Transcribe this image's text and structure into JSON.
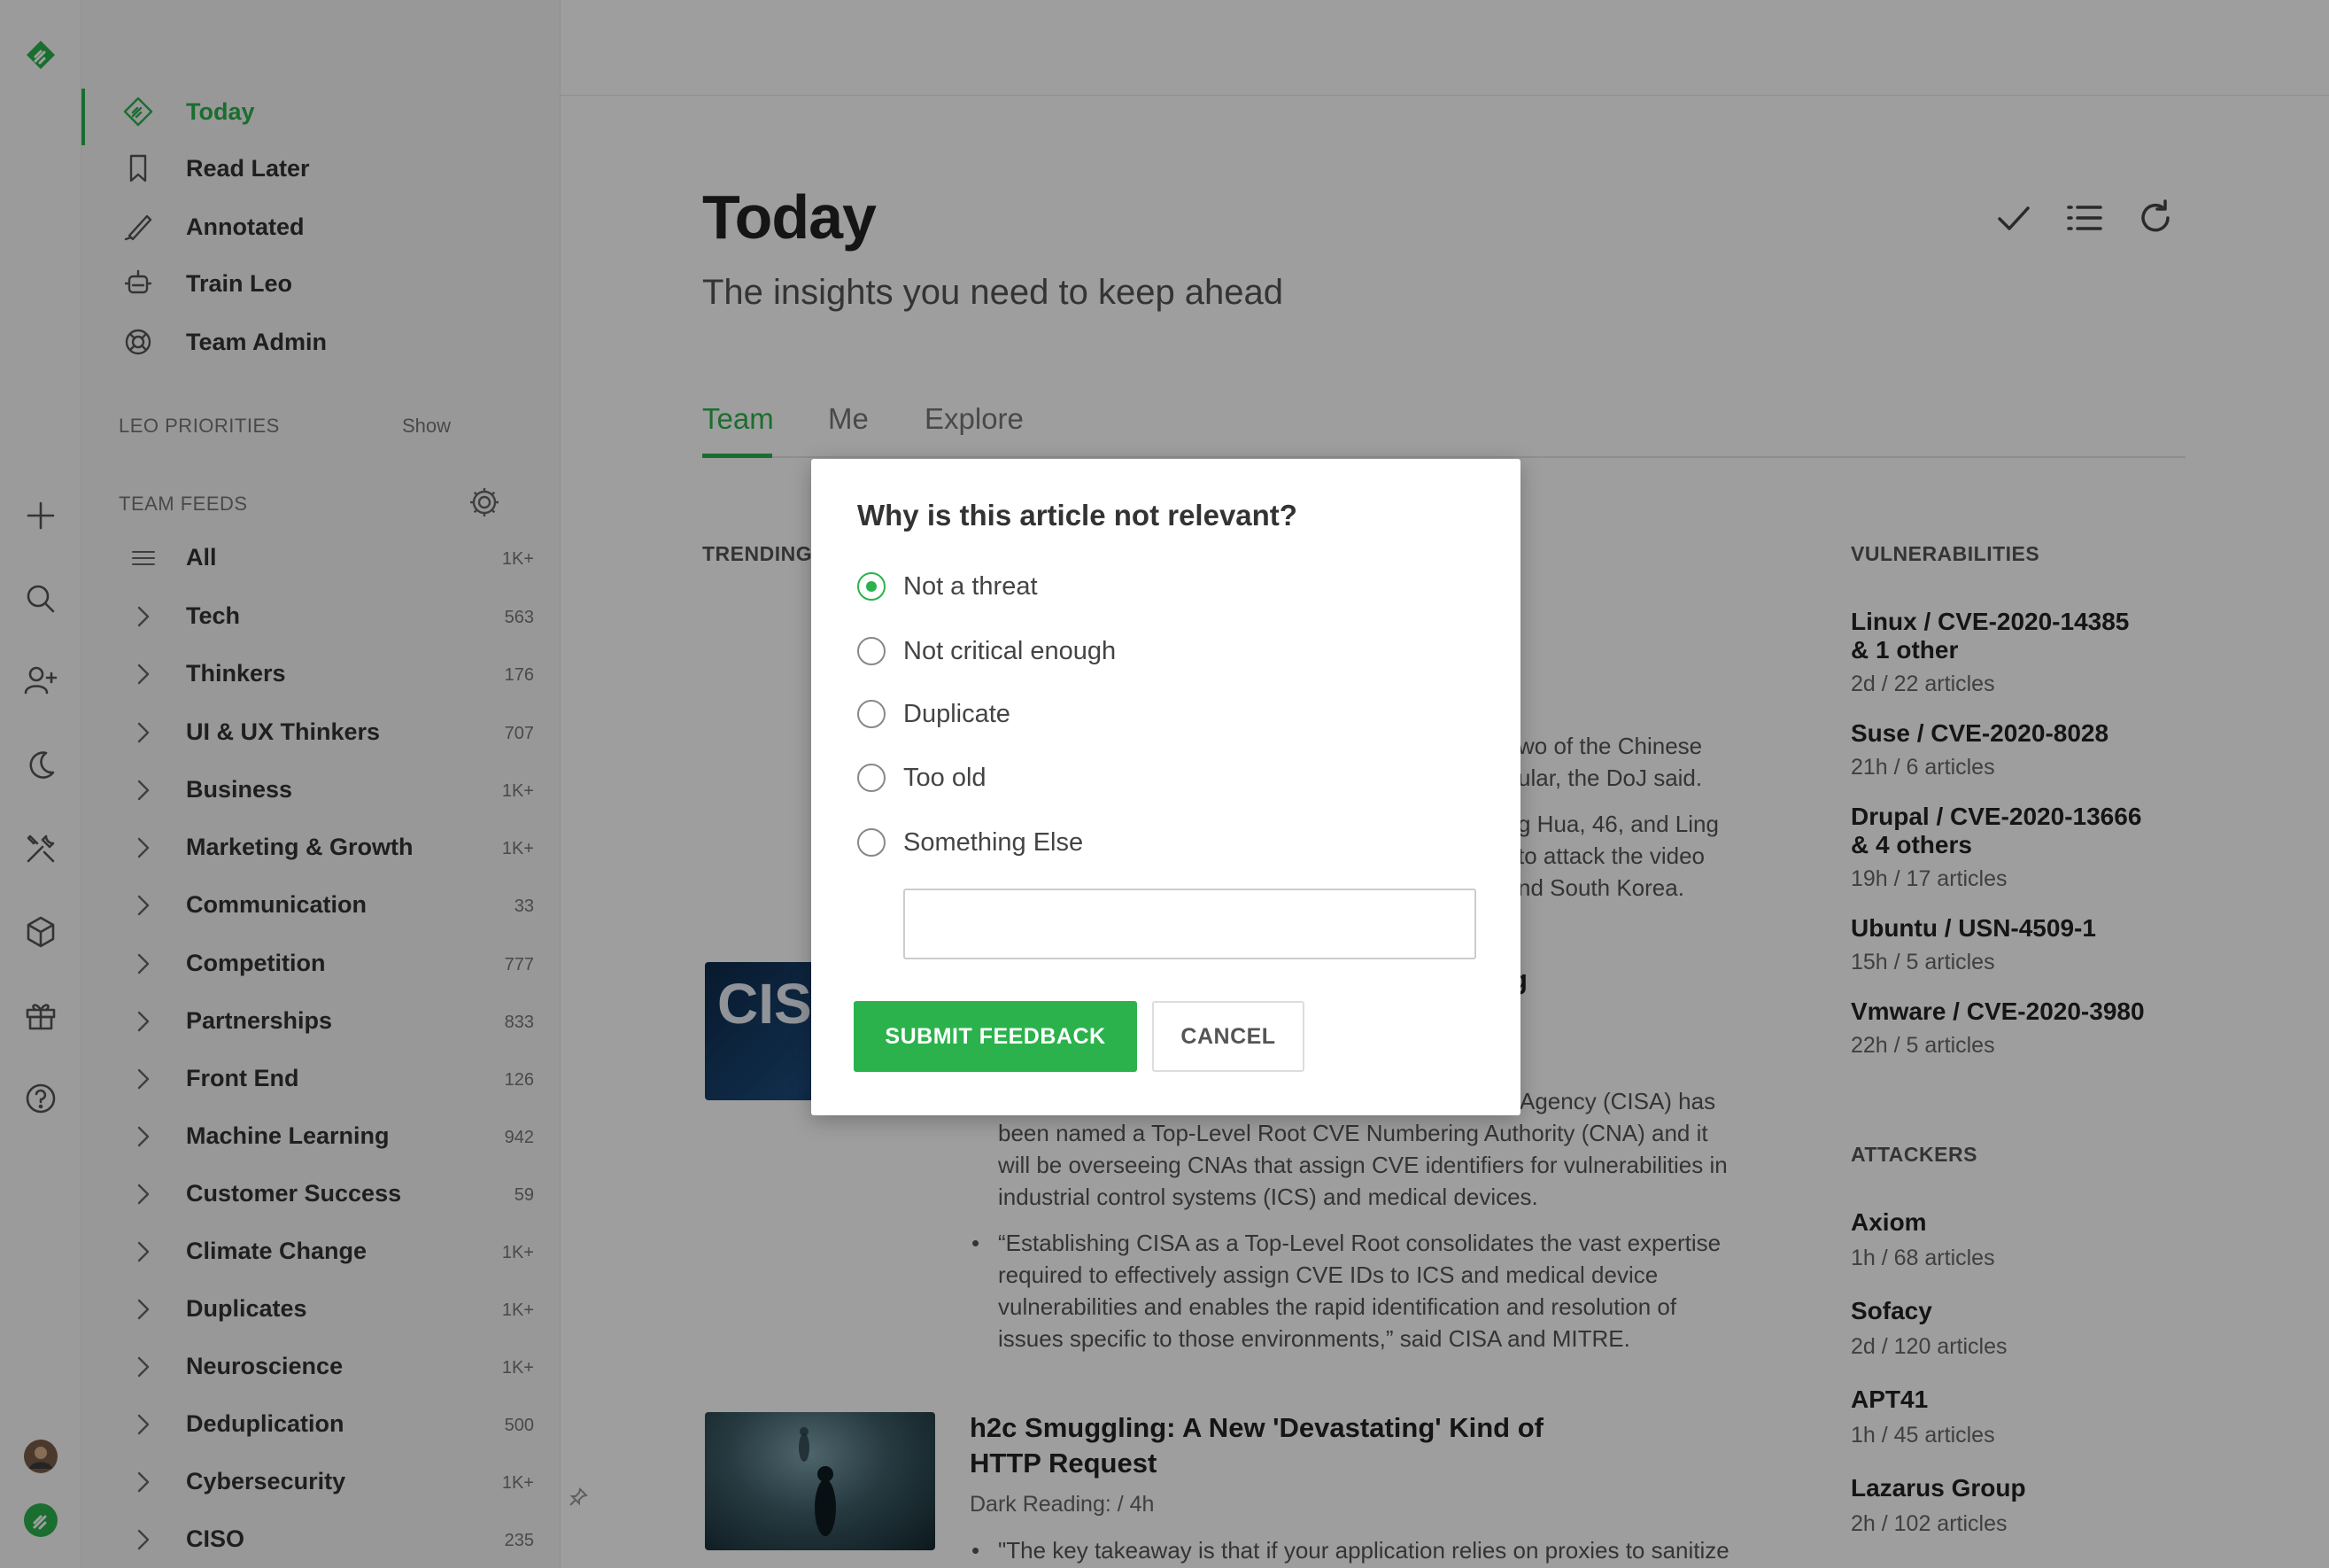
{
  "sidebar": {
    "nav": [
      {
        "label": "Today",
        "icon": "today-icon",
        "active": true
      },
      {
        "label": "Read Later",
        "icon": "bookmark-icon"
      },
      {
        "label": "Annotated",
        "icon": "highlighter-icon"
      },
      {
        "label": "Train Leo",
        "icon": "robot-icon"
      },
      {
        "label": "Team Admin",
        "icon": "lifebuoy-icon"
      }
    ],
    "leo_priorities": {
      "header": "LEO PRIORITIES",
      "action": "Show"
    },
    "team_feeds": {
      "header": "TEAM FEEDS",
      "items": [
        {
          "name": "All",
          "count": "1K+"
        },
        {
          "name": "Tech",
          "count": "563"
        },
        {
          "name": "Thinkers",
          "count": "176"
        },
        {
          "name": "UI & UX Thinkers",
          "count": "707"
        },
        {
          "name": "Business",
          "count": "1K+"
        },
        {
          "name": "Marketing & Growth",
          "count": "1K+"
        },
        {
          "name": "Communication",
          "count": "33"
        },
        {
          "name": "Competition",
          "count": "777"
        },
        {
          "name": "Partnerships",
          "count": "833"
        },
        {
          "name": "Front End",
          "count": "126"
        },
        {
          "name": "Machine Learning",
          "count": "942"
        },
        {
          "name": "Customer Success",
          "count": "59"
        },
        {
          "name": "Climate Change",
          "count": "1K+"
        },
        {
          "name": "Duplicates",
          "count": "1K+"
        },
        {
          "name": "Neuroscience",
          "count": "1K+"
        },
        {
          "name": "Deduplication",
          "count": "500"
        },
        {
          "name": "Cybersecurity",
          "count": "1K+"
        },
        {
          "name": "CISO",
          "count": "235"
        }
      ]
    }
  },
  "main": {
    "title": "Today",
    "subtitle": "The insights you need to keep ahead",
    "tabs": [
      {
        "label": "Team",
        "active": true
      },
      {
        "label": "Me"
      },
      {
        "label": "Explore"
      }
    ],
    "trending_header": "TRENDING",
    "article1": {
      "text_lines": [
        "wo of the Chinese",
        "ular, the DoJ said.",
        "g Hua, 46, and Ling",
        "to attack the video",
        "nd South Korea."
      ]
    },
    "article2": {
      "title_fragment": "g",
      "thumb_text": "CISO",
      "body_lines": [
        "Agency (CISA) has",
        "been named a Top-Level Root CVE Numbering Authority (CNA) and it",
        "will be overseeing CNAs that assign CVE identifiers for vulnerabilities in",
        "industrial control systems (ICS) and medical devices."
      ],
      "bullet_lines": [
        "“Establishing CISA as a Top-Level Root consolidates the vast expertise",
        "required to effectively assign CVE IDs to ICS and medical device",
        "vulnerabilities and enables the rapid identification and resolution of",
        "issues specific to those environments,” said CISA and MITRE."
      ]
    },
    "article3": {
      "title_line1": "h2c Smuggling: A New 'Devastating' Kind of",
      "title_line2": "HTTP Request",
      "source": "Dark Reading: / 4h",
      "bullet": "\"The key takeaway is that if your application relies on proxies to sanitize"
    },
    "vulnerabilities": {
      "header": "VULNERABILITIES",
      "items": [
        {
          "line1": "Linux / CVE-2020-14385",
          "line2": "& 1 other",
          "meta": "2d  /  22 articles"
        },
        {
          "line1": "Suse / CVE-2020-8028",
          "line2": "",
          "meta": "21h  /  6 articles"
        },
        {
          "line1": "Drupal / CVE-2020-13666",
          "line2": "& 4 others",
          "meta": "19h  /  17 articles"
        },
        {
          "line1": "Ubuntu / USN-4509-1",
          "line2": "",
          "meta": "15h  /  5 articles"
        },
        {
          "line1": "Vmware / CVE-2020-3980",
          "line2": "",
          "meta": "22h  /  5 articles"
        }
      ]
    },
    "attackers": {
      "header": "ATTACKERS",
      "items": [
        {
          "name": "Axiom",
          "meta": "1h  /  68 articles"
        },
        {
          "name": "Sofacy",
          "meta": "2d  /  120 articles"
        },
        {
          "name": "APT41",
          "meta": "1h  /  45 articles"
        },
        {
          "name": "Lazarus Group",
          "meta": "2h  /  102 articles"
        }
      ]
    }
  },
  "modal": {
    "title": "Why is this article not relevant?",
    "options": [
      {
        "label": "Not a threat",
        "selected": true
      },
      {
        "label": "Not critical enough",
        "selected": false
      },
      {
        "label": "Duplicate",
        "selected": false
      },
      {
        "label": "Too old",
        "selected": false
      },
      {
        "label": "Something Else",
        "selected": false
      }
    ],
    "other_value": "",
    "submit_label": "SUBMIT FEEDBACK",
    "cancel_label": "CANCEL"
  },
  "colors": {
    "accent": "#2bb24c"
  }
}
